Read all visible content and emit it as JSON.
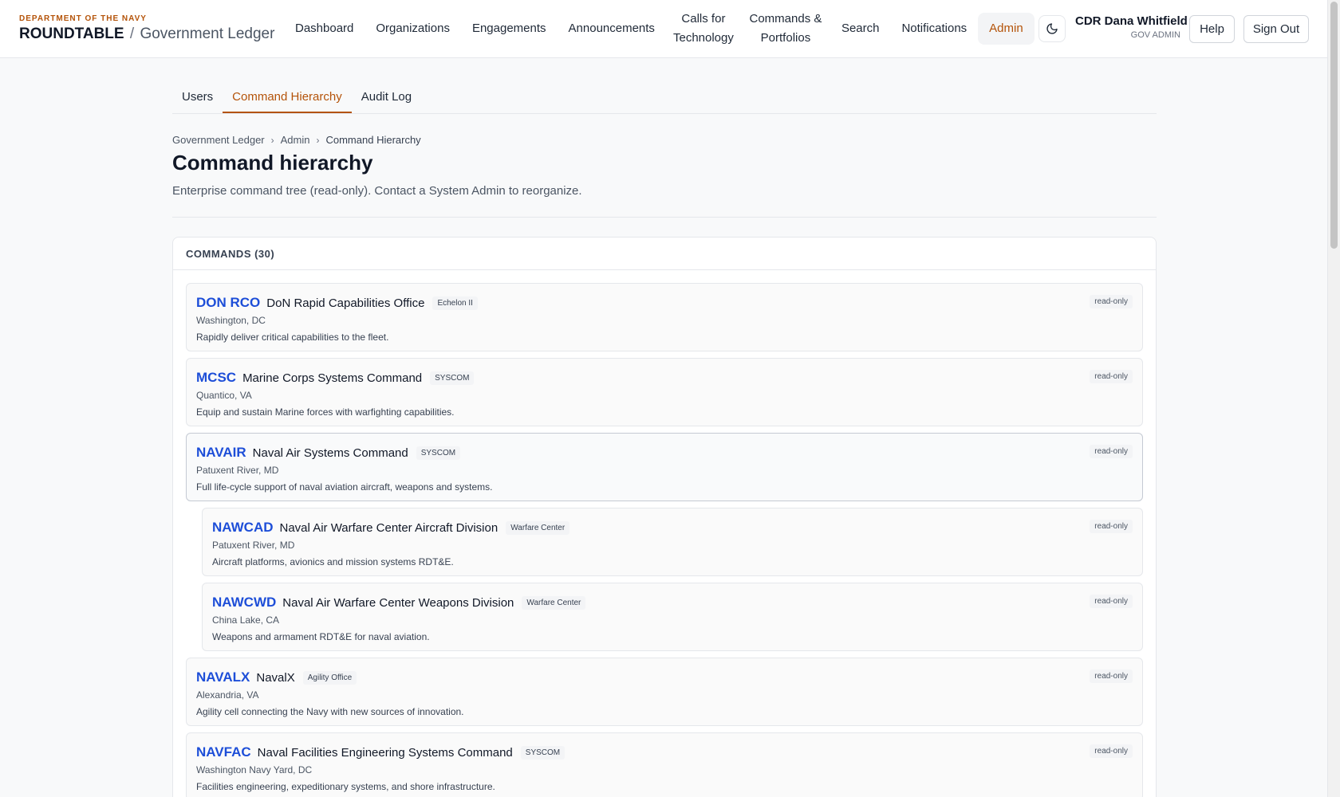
{
  "brand": {
    "department": "DEPARTMENT OF THE NAVY",
    "name": "ROUNDTABLE",
    "separator": "/",
    "subtitle": "Government Ledger"
  },
  "nav": {
    "items": [
      {
        "label": "Dashboard"
      },
      {
        "label": "Organizations"
      },
      {
        "label": "Engagements"
      },
      {
        "label": "Announcements"
      },
      {
        "label": "Calls for Technology"
      },
      {
        "label": "Commands & Portfolios"
      },
      {
        "label": "Search"
      },
      {
        "label": "Notifications"
      },
      {
        "label": "Admin"
      }
    ],
    "active": "Admin"
  },
  "header": {
    "theme_icon": "moon-icon",
    "user_name": "CDR Dana Whitfield",
    "user_role": "GOV ADMIN",
    "help_label": "Help",
    "signout_label": "Sign Out"
  },
  "tabs": [
    {
      "label": "Users"
    },
    {
      "label": "Command Hierarchy"
    },
    {
      "label": "Audit Log"
    }
  ],
  "active_tab": "Command Hierarchy",
  "breadcrumb": [
    "Government Ledger",
    "Admin",
    "Command Hierarchy"
  ],
  "page": {
    "title": "Command hierarchy",
    "description": "Enterprise command tree (read-only). Contact a System Admin to reorganize."
  },
  "panel": {
    "heading": "COMMANDS (30)"
  },
  "commands": [
    {
      "code": "DON RCO",
      "name": "DoN Rapid Capabilities Office",
      "badge": "Echelon II",
      "location": "Washington, DC",
      "description": "Rapidly deliver critical capabilities to the fleet.",
      "status": "read-only",
      "level": 0
    },
    {
      "code": "MCSC",
      "name": "Marine Corps Systems Command",
      "badge": "SYSCOM",
      "location": "Quantico, VA",
      "description": "Equip and sustain Marine forces with warfighting capabilities.",
      "status": "read-only",
      "level": 0
    },
    {
      "code": "NAVAIR",
      "name": "Naval Air Systems Command",
      "badge": "SYSCOM",
      "location": "Patuxent River, MD",
      "description": "Full life-cycle support of naval aviation aircraft, weapons and systems.",
      "status": "read-only",
      "level": 0
    },
    {
      "code": "NAWCAD",
      "name": "Naval Air Warfare Center Aircraft Division",
      "badge": "Warfare Center",
      "location": "Patuxent River, MD",
      "description": "Aircraft platforms, avionics and mission systems RDT&E.",
      "status": "read-only",
      "level": 1
    },
    {
      "code": "NAWCWD",
      "name": "Naval Air Warfare Center Weapons Division",
      "badge": "Warfare Center",
      "location": "China Lake, CA",
      "description": "Weapons and armament RDT&E for naval aviation.",
      "status": "read-only",
      "level": 1
    },
    {
      "code": "NAVALX",
      "name": "NavalX",
      "badge": "Agility Office",
      "location": "Alexandria, VA",
      "description": "Agility cell connecting the Navy with new sources of innovation.",
      "status": "read-only",
      "level": 0
    },
    {
      "code": "NAVFAC",
      "name": "Naval Facilities Engineering Systems Command",
      "badge": "SYSCOM",
      "location": "Washington Navy Yard, DC",
      "description": "Facilities engineering, expeditionary systems, and shore infrastructure.",
      "status": "read-only",
      "level": 0
    }
  ]
}
